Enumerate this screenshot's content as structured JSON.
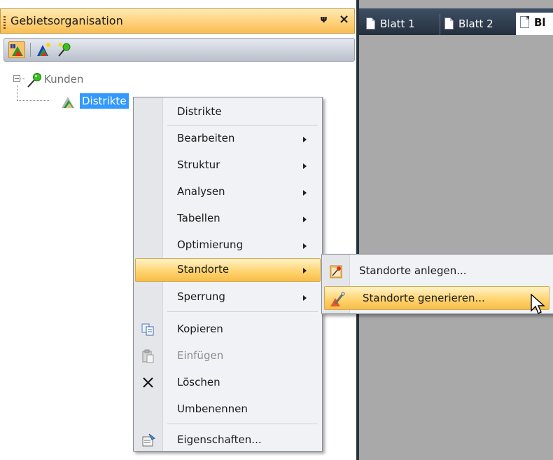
{
  "panel": {
    "title": "Gebietsorganisation",
    "pin_glyph": "1",
    "close_glyph": "×"
  },
  "toolbar": {
    "buttons": [
      {
        "icon": "area-organization-icon"
      },
      {
        "icon": "new-level-icon"
      },
      {
        "icon": "new-location-pin-icon"
      }
    ]
  },
  "tree": {
    "root_label": "Kunden",
    "child_label": "Distrikte"
  },
  "tabs": [
    {
      "label": "Blatt 1"
    },
    {
      "label": "Blatt 2"
    },
    {
      "label": "Bl"
    }
  ],
  "context_menu": {
    "header": "Distrikte",
    "items": [
      {
        "label": "Bearbeiten",
        "submenu": true
      },
      {
        "label": "Struktur",
        "submenu": true
      },
      {
        "label": "Analysen",
        "submenu": true
      },
      {
        "label": "Tabellen",
        "submenu": true
      },
      {
        "label": "Optimierung",
        "submenu": true
      },
      {
        "label": "Standorte",
        "submenu": true,
        "highlighted": true
      },
      {
        "label": "Sperrung",
        "submenu": true
      },
      {
        "label": "Kopieren",
        "icon": "copy-icon"
      },
      {
        "label": "Einfügen",
        "icon": "paste-icon",
        "disabled": true
      },
      {
        "label": "Löschen",
        "icon": "delete-icon"
      },
      {
        "label": "Umbenennen"
      },
      {
        "label": "Eigenschaften...",
        "icon": "properties-icon"
      }
    ]
  },
  "submenu": {
    "items": [
      {
        "label": "Standorte anlegen...",
        "icon": "create-locations-icon"
      },
      {
        "label": "Standorte generieren...",
        "icon": "generate-locations-icon",
        "highlighted": true
      }
    ]
  },
  "colors": {
    "title_bar": "#ffd27c",
    "selection": "#3399ff",
    "menu_highlight": "#ffd26a",
    "tab_strip": "#2f3b4b",
    "workspace": "#a9a9a9"
  }
}
